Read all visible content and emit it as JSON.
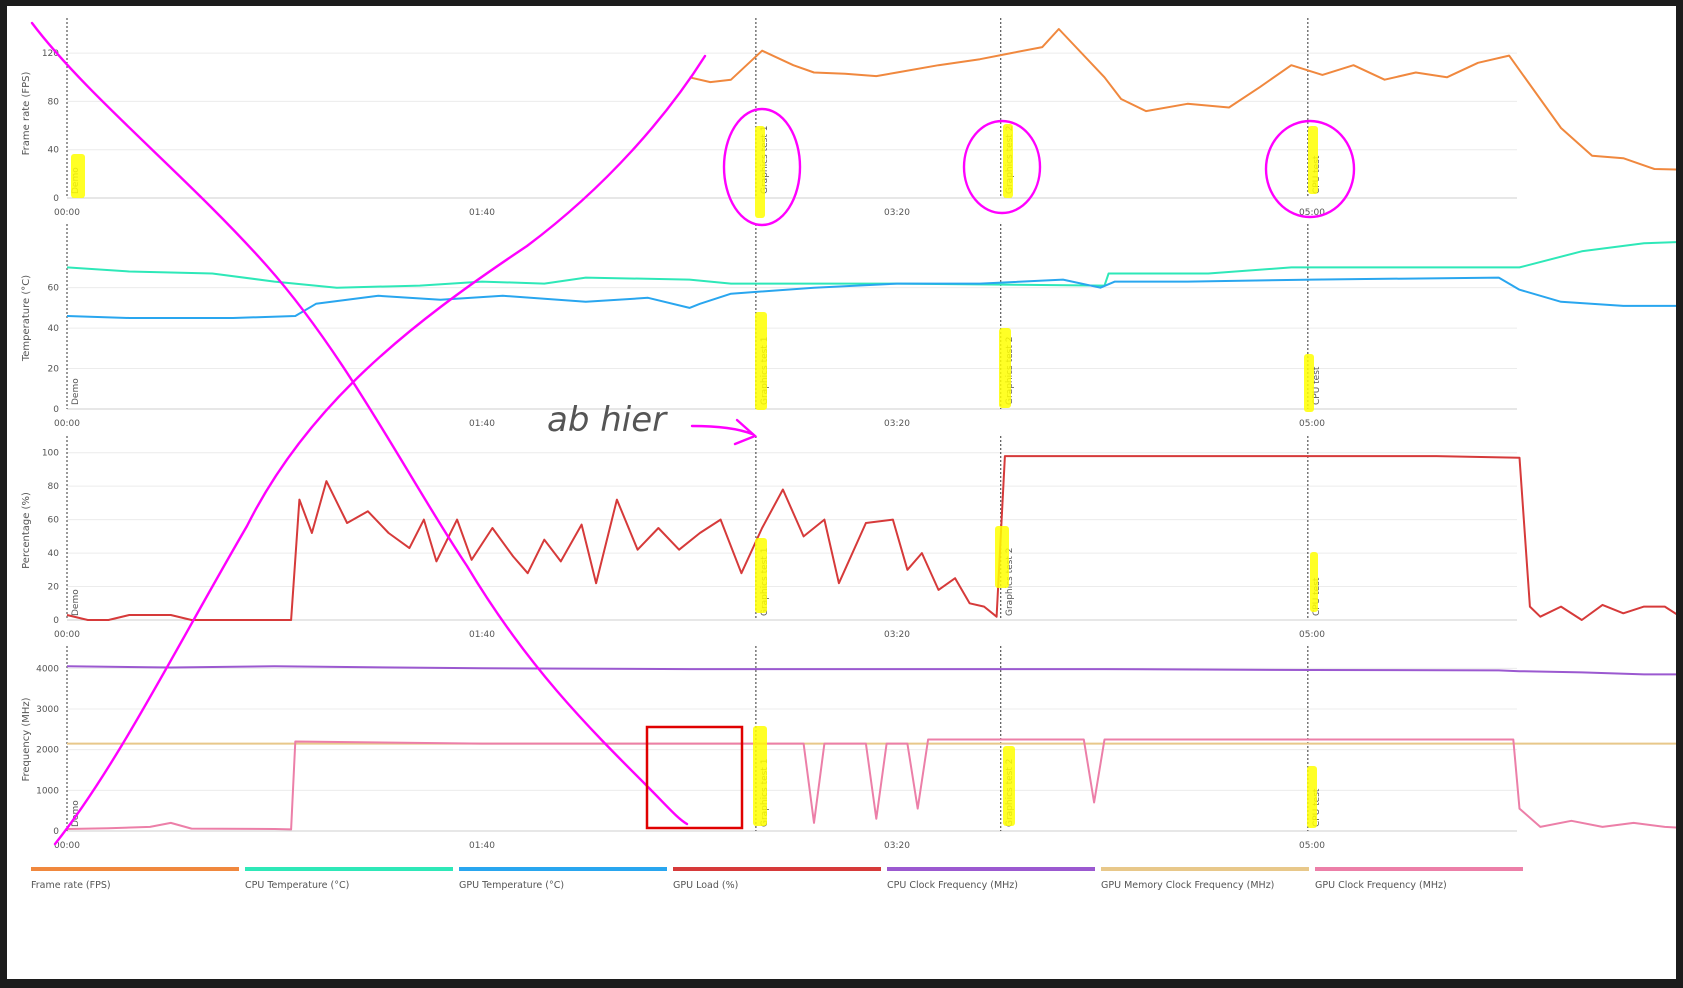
{
  "chart_data": [
    {
      "type": "line",
      "ylabel": "Frame rate (FPS)",
      "ylim": [
        0,
        140
      ],
      "yticks": [
        0,
        40,
        80,
        120
      ],
      "series": [
        {
          "key": "fps",
          "values": [
            [
              3.0,
              100
            ],
            [
              3.1,
              96
            ],
            [
              3.2,
              98
            ],
            [
              3.35,
              122
            ],
            [
              3.5,
              110
            ],
            [
              3.6,
              104
            ],
            [
              3.75,
              103
            ],
            [
              3.9,
              101
            ],
            [
              4.0,
              104
            ],
            [
              4.2,
              110
            ],
            [
              4.4,
              115
            ],
            [
              4.55,
              120
            ],
            [
              4.7,
              125
            ],
            [
              4.78,
              140
            ],
            [
              5.0,
              100
            ],
            [
              5.08,
              82
            ],
            [
              5.2,
              72
            ],
            [
              5.4,
              78
            ],
            [
              5.6,
              75
            ],
            [
              5.75,
              92
            ],
            [
              5.9,
              110
            ],
            [
              6.05,
              102
            ],
            [
              6.2,
              110
            ],
            [
              6.35,
              98
            ],
            [
              6.5,
              104
            ],
            [
              6.65,
              100
            ],
            [
              6.8,
              112
            ],
            [
              6.95,
              118
            ],
            [
              7.2,
              58
            ],
            [
              7.35,
              35
            ],
            [
              7.5,
              33
            ],
            [
              7.65,
              24
            ],
            [
              7.9,
              23
            ]
          ]
        }
      ]
    },
    {
      "type": "line",
      "ylabel": "Temperature (°C)",
      "ylim": [
        0,
        90
      ],
      "yticks": [
        0,
        20,
        40,
        60
      ],
      "series": [
        {
          "key": "cpu_temp",
          "values": [
            [
              0,
              70
            ],
            [
              0.3,
              68
            ],
            [
              0.7,
              67
            ],
            [
              1.0,
              63
            ],
            [
              1.3,
              60
            ],
            [
              1.7,
              61
            ],
            [
              2.0,
              63
            ],
            [
              2.3,
              62
            ],
            [
              2.5,
              65
            ],
            [
              3.0,
              64
            ],
            [
              3.2,
              62
            ],
            [
              4.0,
              62
            ],
            [
              5.0,
              61
            ],
            [
              5.02,
              67
            ],
            [
              5.5,
              67
            ],
            [
              5.9,
              70
            ],
            [
              6.5,
              70
            ],
            [
              7.0,
              70
            ],
            [
              7.3,
              78
            ],
            [
              7.6,
              82
            ],
            [
              7.9,
              83
            ]
          ]
        },
        {
          "key": "gpu_temp",
          "values": [
            [
              0,
              46
            ],
            [
              0.3,
              45
            ],
            [
              0.8,
              45
            ],
            [
              1.1,
              46
            ],
            [
              1.2,
              52
            ],
            [
              1.5,
              56
            ],
            [
              1.8,
              54
            ],
            [
              2.1,
              56
            ],
            [
              2.5,
              53
            ],
            [
              2.8,
              55
            ],
            [
              3.0,
              50
            ],
            [
              3.05,
              52
            ],
            [
              3.2,
              57
            ],
            [
              3.6,
              60
            ],
            [
              4.0,
              62
            ],
            [
              4.4,
              62
            ],
            [
              4.8,
              64
            ],
            [
              4.98,
              60
            ],
            [
              5.05,
              63
            ],
            [
              5.4,
              63
            ],
            [
              6.0,
              64
            ],
            [
              6.9,
              65
            ],
            [
              7.0,
              59
            ],
            [
              7.2,
              53
            ],
            [
              7.5,
              51
            ],
            [
              7.9,
              51
            ]
          ]
        }
      ]
    },
    {
      "type": "line",
      "ylabel": "Percentage (%)",
      "ylim": [
        0,
        107
      ],
      "yticks": [
        0,
        20,
        40,
        60,
        80,
        100
      ],
      "series": [
        {
          "key": "gpu_load",
          "values": [
            [
              0,
              3
            ],
            [
              0.1,
              0
            ],
            [
              0.2,
              0
            ],
            [
              0.3,
              3
            ],
            [
              0.5,
              3
            ],
            [
              0.6,
              0
            ],
            [
              1.08,
              0
            ],
            [
              1.12,
              72
            ],
            [
              1.18,
              52
            ],
            [
              1.25,
              83
            ],
            [
              1.35,
              58
            ],
            [
              1.45,
              65
            ],
            [
              1.55,
              52
            ],
            [
              1.65,
              43
            ],
            [
              1.72,
              60
            ],
            [
              1.78,
              35
            ],
            [
              1.88,
              60
            ],
            [
              1.95,
              36
            ],
            [
              2.05,
              55
            ],
            [
              2.15,
              38
            ],
            [
              2.22,
              28
            ],
            [
              2.3,
              48
            ],
            [
              2.38,
              35
            ],
            [
              2.48,
              57
            ],
            [
              2.55,
              22
            ],
            [
              2.65,
              72
            ],
            [
              2.75,
              42
            ],
            [
              2.85,
              55
            ],
            [
              2.95,
              42
            ],
            [
              3.05,
              52
            ],
            [
              3.15,
              60
            ],
            [
              3.25,
              28
            ],
            [
              3.35,
              55
            ],
            [
              3.45,
              78
            ],
            [
              3.55,
              50
            ],
            [
              3.65,
              60
            ],
            [
              3.72,
              22
            ],
            [
              3.85,
              58
            ],
            [
              3.98,
              60
            ],
            [
              4.05,
              30
            ],
            [
              4.12,
              40
            ],
            [
              4.2,
              18
            ],
            [
              4.28,
              25
            ],
            [
              4.35,
              10
            ],
            [
              4.42,
              8
            ],
            [
              4.48,
              2
            ],
            [
              4.52,
              98
            ],
            [
              5.0,
              98
            ],
            [
              5.5,
              98
            ],
            [
              6.0,
              98
            ],
            [
              6.35,
              98
            ],
            [
              6.6,
              98
            ],
            [
              7.0,
              97
            ],
            [
              7.05,
              8
            ],
            [
              7.1,
              2
            ],
            [
              7.2,
              8
            ],
            [
              7.3,
              0
            ],
            [
              7.4,
              9
            ],
            [
              7.5,
              4
            ],
            [
              7.6,
              8
            ],
            [
              7.7,
              8
            ],
            [
              7.8,
              0
            ],
            [
              7.9,
              0
            ]
          ]
        }
      ]
    },
    {
      "type": "line",
      "ylabel": "Frequency (MHz)",
      "ylim": [
        0,
        4500
      ],
      "yticks": [
        0,
        1000,
        2000,
        3000,
        4000
      ],
      "series": [
        {
          "key": "cpu_clock",
          "values": [
            [
              0,
              4050
            ],
            [
              0.5,
              4020
            ],
            [
              1.0,
              4050
            ],
            [
              2.0,
              4000
            ],
            [
              3.0,
              3980
            ],
            [
              4.0,
              3980
            ],
            [
              5.0,
              3980
            ],
            [
              6.0,
              3960
            ],
            [
              6.9,
              3950
            ],
            [
              7.0,
              3930
            ],
            [
              7.3,
              3900
            ],
            [
              7.6,
              3850
            ],
            [
              7.85,
              3850
            ],
            [
              7.9,
              3960
            ]
          ]
        },
        {
          "key": "gpu_mem_clock",
          "values": [
            [
              0,
              2150
            ],
            [
              2.0,
              2150
            ],
            [
              4.0,
              2150
            ],
            [
              6.0,
              2150
            ],
            [
              7.9,
              2150
            ]
          ]
        },
        {
          "key": "gpu_clock",
          "values": [
            [
              0,
              50
            ],
            [
              0.2,
              70
            ],
            [
              0.4,
              100
            ],
            [
              0.5,
              200
            ],
            [
              0.6,
              60
            ],
            [
              1.0,
              50
            ],
            [
              1.08,
              40
            ],
            [
              1.1,
              2200
            ],
            [
              2.0,
              2150
            ],
            [
              3.0,
              2150
            ],
            [
              3.55,
              2150
            ],
            [
              3.6,
              200
            ],
            [
              3.65,
              2150
            ],
            [
              3.85,
              2150
            ],
            [
              3.9,
              300
            ],
            [
              3.95,
              2150
            ],
            [
              4.05,
              2150
            ],
            [
              4.1,
              550
            ],
            [
              4.15,
              2250
            ],
            [
              4.5,
              2250
            ],
            [
              4.9,
              2250
            ],
            [
              4.95,
              700
            ],
            [
              5.0,
              2250
            ],
            [
              6.0,
              2250
            ],
            [
              6.97,
              2250
            ],
            [
              7.0,
              550
            ],
            [
              7.1,
              100
            ],
            [
              7.25,
              250
            ],
            [
              7.4,
              100
            ],
            [
              7.55,
              200
            ],
            [
              7.7,
              100
            ],
            [
              7.9,
              50
            ]
          ]
        }
      ]
    }
  ],
  "x_axis": {
    "ticks": [
      {
        "label": "00:00",
        "x": 0
      },
      {
        "label": "01:40",
        "x": 2
      },
      {
        "label": "03:20",
        "x": 4
      },
      {
        "label": "05:00",
        "x": 6
      }
    ],
    "xlim": [
      0,
      8.1
    ]
  },
  "markers": [
    {
      "label": "Demo",
      "x": 0
    },
    {
      "label": "Graphics test 1",
      "x": 3.32
    },
    {
      "label": "Graphics test 2",
      "x": 4.5
    },
    {
      "label": "CPU test",
      "x": 5.98
    }
  ],
  "legend": [
    {
      "key": "fps",
      "label": "Frame rate (FPS)",
      "color": "#f0883e"
    },
    {
      "key": "cpu_temp",
      "label": "CPU Temperature (°C)",
      "color": "#2ee8b8"
    },
    {
      "key": "gpu_temp",
      "label": "GPU Temperature (°C)",
      "color": "#29a6ef"
    },
    {
      "key": "gpu_load",
      "label": "GPU Load (%)",
      "color": "#d63a3a"
    },
    {
      "key": "cpu_clock",
      "label": "CPU Clock Frequency (MHz)",
      "color": "#9b59d0"
    },
    {
      "key": "gpu_mem_clock",
      "label": "GPU Memory Clock Frequency (MHz)",
      "color": "#e8c88a"
    },
    {
      "key": "gpu_clock",
      "label": "GPU Clock Frequency (MHz)",
      "color": "#ec7fa8"
    }
  ],
  "annotations": {
    "handwritten_note": "ab hier",
    "ink_color": "#ff00ff",
    "highlight_color": "#ffff00",
    "box_color": "#e00000"
  }
}
